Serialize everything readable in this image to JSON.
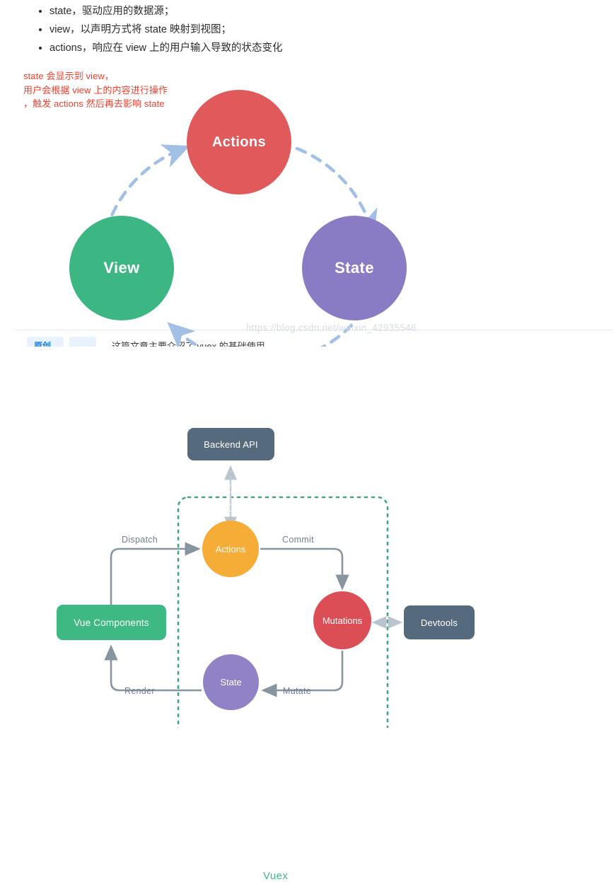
{
  "colors": {
    "actions_red": "#e0595b",
    "view_green": "#3cb682",
    "state_purple": "#8a7cc4",
    "dashed_arrow_blue": "#a8c4e8",
    "vuex_green": "#42b983",
    "slate": "#556a7d",
    "actions_orange": "#f6ad38",
    "mutations_red": "#dc4e55",
    "state2_purple": "#9182c6",
    "annotation_red": "#f4402f",
    "edge_gray": "#8795a1"
  },
  "bullets": [
    "state，驱动应用的数据源；",
    "view，以声明方式将 state 映射到视图；",
    "actions，响应在 view 上的用户输入导致的状态变化"
  ],
  "annotation": {
    "text": "state 会显示到 view，\n用户会根据 view 上的内容进行操作\n，触发 actions 然后再去影响 state"
  },
  "diagram1": {
    "nodes": [
      {
        "id": "actions",
        "label": "Actions"
      },
      {
        "id": "view",
        "label": "View"
      },
      {
        "id": "state",
        "label": "State"
      }
    ],
    "flow": "View → Actions → State → View (dashed circular arrows)"
  },
  "watermark": "https://blog.csdn.net/weixin_42935546",
  "cutoff_row": {
    "chip_label": "原创",
    "text": "这篇文章主要介绍了 vuex 的基础使用"
  },
  "diagram2": {
    "container_label": "Vuex",
    "nodes": {
      "backend": "Backend API",
      "devtools": "Devtools",
      "vue_components": "Vue Components",
      "actions": "Actions",
      "mutations": "Mutations",
      "state": "State"
    },
    "edges": {
      "dispatch": "Dispatch",
      "commit": "Commit",
      "render": "Render",
      "mutate": "Mutate"
    }
  }
}
